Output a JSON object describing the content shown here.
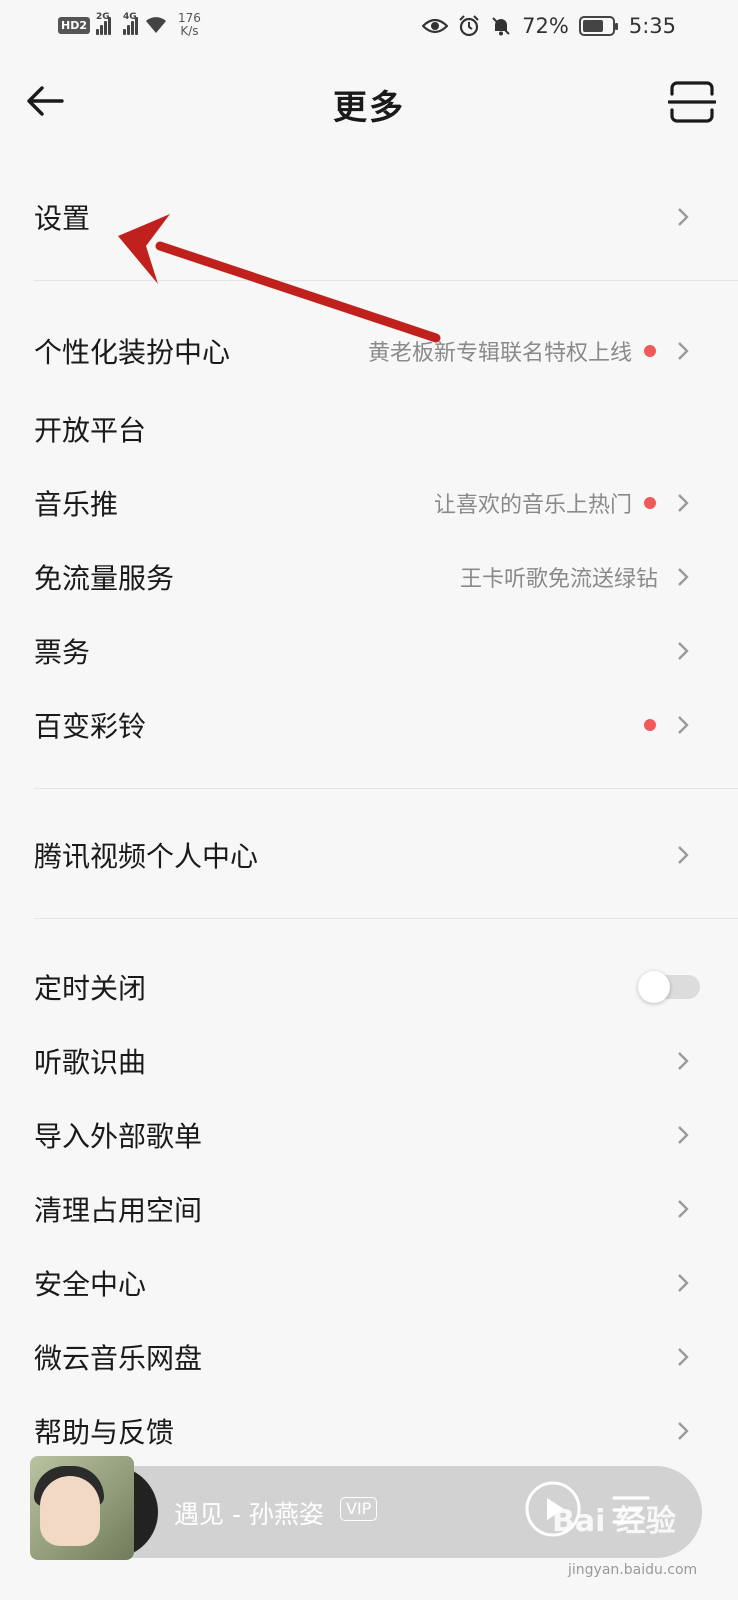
{
  "status_bar": {
    "hd": "HD",
    "hd_num": "2",
    "net1": "2G",
    "net2": "4G",
    "speed_value": "176",
    "speed_unit": "K/s",
    "battery": "72%",
    "battery_level": 0.72,
    "time": "5:35"
  },
  "header": {
    "title": "更多"
  },
  "menu": {
    "settings": "设置",
    "theme_center": "个性化装扮中心",
    "theme_center_sub": "黄老板新专辑联名特权上线",
    "open_platform": "开放平台",
    "music_push": "音乐推",
    "music_push_sub": "让喜欢的音乐上热门",
    "free_data": "免流量服务",
    "free_data_sub": "王卡听歌免流送绿钻",
    "tickets": "票务",
    "ringtone": "百变彩铃",
    "tencent_video": "腾讯视频个人中心",
    "timer_off": "定时关闭",
    "timer_off_on": false,
    "song_recognition": "听歌识曲",
    "import_playlist": "导入外部歌单",
    "clean_space": "清理占用空间",
    "security_center": "安全中心",
    "weiyun_disk": "微云音乐网盘",
    "help_feedback": "帮助与反馈"
  },
  "player": {
    "song": "遇见 - 孙燕姿",
    "vip": "VIP"
  },
  "watermark": {
    "text": "Bai 经验",
    "sub": "jingyan.baidu.com"
  },
  "colors": {
    "background": "#f7f7f7",
    "red_dot": "#f05a5a",
    "annotation_arrow": "#c0211d"
  }
}
